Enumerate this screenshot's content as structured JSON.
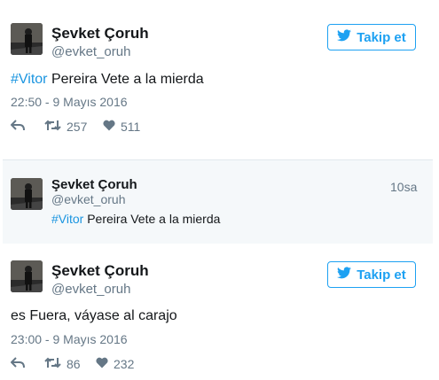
{
  "tweet1": {
    "name": "Şevket Çoruh",
    "handle": "@evket_oruh",
    "follow_label": "Takip et",
    "hashtag": "#Vitor",
    "text": " Pereira Vete a la mierda",
    "timestamp": "22:50 - 9 Mayıs 2016",
    "retweets": "257",
    "likes": "511"
  },
  "quoted": {
    "name": "Şevket Çoruh",
    "handle": "@evket_oruh",
    "time_ago": "10sa",
    "hashtag": "#Vitor",
    "text": " Pereira Vete a la mierda"
  },
  "tweet2": {
    "name": "Şevket Çoruh",
    "handle": "@evket_oruh",
    "follow_label": "Takip et",
    "text": "es Fuera, váyase al carajo",
    "timestamp": "23:00 - 9 Mayıs 2016",
    "retweets": "86",
    "likes": "232"
  },
  "icons": {
    "twitter": "twitter-bird-icon",
    "reply": "reply-icon",
    "retweet": "retweet-icon",
    "like": "heart-icon"
  },
  "colors": {
    "accent": "#1da1f2",
    "hashtag": "#1b95e0",
    "muted": "#657786",
    "quoted_bg": "#f5f8fa"
  }
}
